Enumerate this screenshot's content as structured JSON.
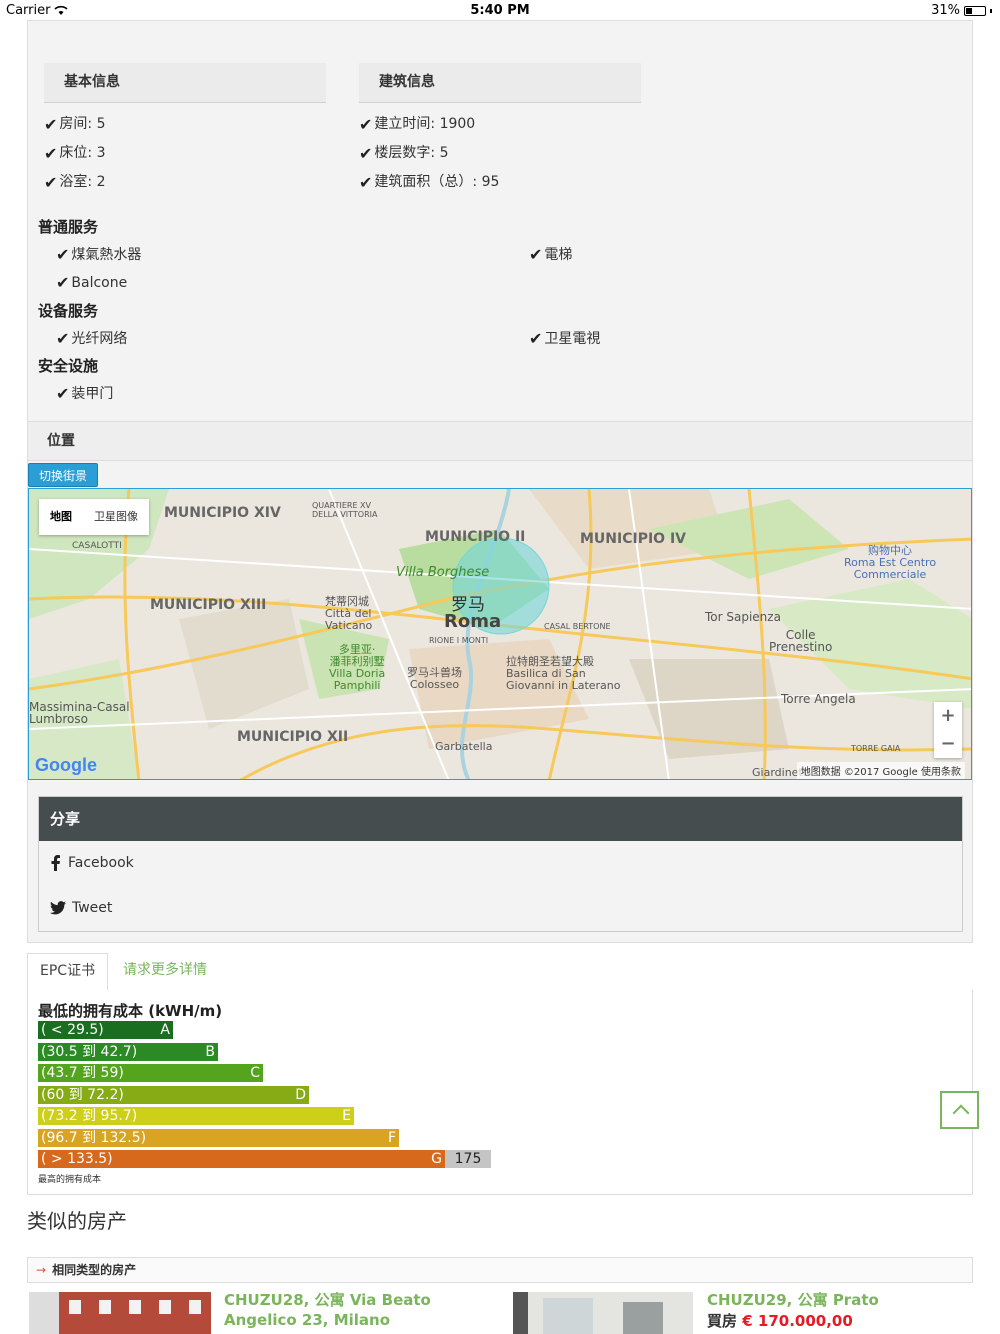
{
  "status_bar": {
    "carrier": "Carrier",
    "time": "5:40 PM",
    "battery": "31%"
  },
  "basic_info": {
    "heading": "基本信息",
    "items": [
      "房间: 5",
      "床位: 3",
      "浴室: 2"
    ]
  },
  "building_info": {
    "heading": "建筑信息",
    "items": [
      "建立时间: 1900",
      "楼层数字: 5",
      "建筑面积（总）: 95"
    ]
  },
  "services": {
    "general": {
      "title": "普通服务",
      "items": [
        "煤氣熱水器",
        "電梯",
        "Balcone"
      ]
    },
    "equipment": {
      "title": "设备服务",
      "items": [
        "光纤网络",
        "卫星電視"
      ]
    },
    "security": {
      "title": "安全设施",
      "items": [
        "装甲门"
      ]
    }
  },
  "location": {
    "heading": "位置",
    "street_view_button": "切换街景",
    "map_type": {
      "map": "地图",
      "satellite": "卫星图像"
    },
    "labels": {
      "municipio_xiv": "MUNICIPIO XIV",
      "municipio_ii": "MUNICIPIO II",
      "municipio_iv": "MUNICIPIO IV",
      "municipio_xiii": "MUNICIPIO XIII",
      "municipio_xii": "MUNICIPIO XII",
      "roma_cn": "罗马",
      "roma": "Roma",
      "villa_borghese": "Villa Borghese",
      "vaticano": "梵蒂冈城\nCittà del\nVaticano",
      "colosseo": "罗马斗兽场\nColosseo",
      "laterano": "拉特朗圣若望大殿\nBasilica di San\nGiovanni in Laterano",
      "tor_sapienza": "Tor Sapienza",
      "torre_angela": "Torre Angela",
      "casalotti": "CASALOTTI",
      "lumbroso": "Massimina-Casal\nLumbroso",
      "garbatella": "Garbatella",
      "giardinetti": "Giardinetti",
      "roma_est": "购物中心\nRoma Est Centro\nCommerciale",
      "colle": "Colle\nPrenestino",
      "doria": "多里亚·\n潘菲利别墅\nVilla Doria\nPamphili",
      "rione": "RIONE I MONTI",
      "casal_bertone": "CASAL BERTONE",
      "torre_gaia": "TORRE GAIA",
      "quartiere": "QUARTIERE XV\nDELLA VITTORIA"
    },
    "zoom_in": "+",
    "zoom_out": "−",
    "google": "Google",
    "footer": "地图数据 ©2017 Google    使用条款"
  },
  "share": {
    "heading": "分享",
    "facebook": "Facebook",
    "tweet": "Tweet"
  },
  "tabs": {
    "epc": "EPC证书",
    "request": "请求更多详情"
  },
  "epc": {
    "title": "最低的拥有成本 (kWH/m)",
    "footer": "最高的拥有成本",
    "current_value": "175",
    "bands": [
      {
        "range": "( < 29.5)",
        "letter": "A",
        "color": "#1a6e1f"
      },
      {
        "range": "(30.5 到 42.7)",
        "letter": "B",
        "color": "#2b8a24"
      },
      {
        "range": "(43.7 到 59)",
        "letter": "C",
        "color": "#55a41e"
      },
      {
        "range": "(60 到 72.2)",
        "letter": "D",
        "color": "#86ab14"
      },
      {
        "range": "(73.2 到 95.7)",
        "letter": "E",
        "color": "#cdcf18"
      },
      {
        "range": "(96.7 到 132.5)",
        "letter": "F",
        "color": "#d8a421"
      },
      {
        "range": "( > 133.5)",
        "letter": "G",
        "color": "#d6691b"
      }
    ]
  },
  "similar": {
    "title": "类似的房产",
    "bar": "相同类型的房产",
    "properties": [
      {
        "title": "CHUZU28, 公寓 Via Beato Angelico 23, Milano"
      },
      {
        "title": "CHUZU29, 公寓 Prato",
        "price_label": "買房",
        "price": "€ 170.000,00"
      }
    ]
  }
}
